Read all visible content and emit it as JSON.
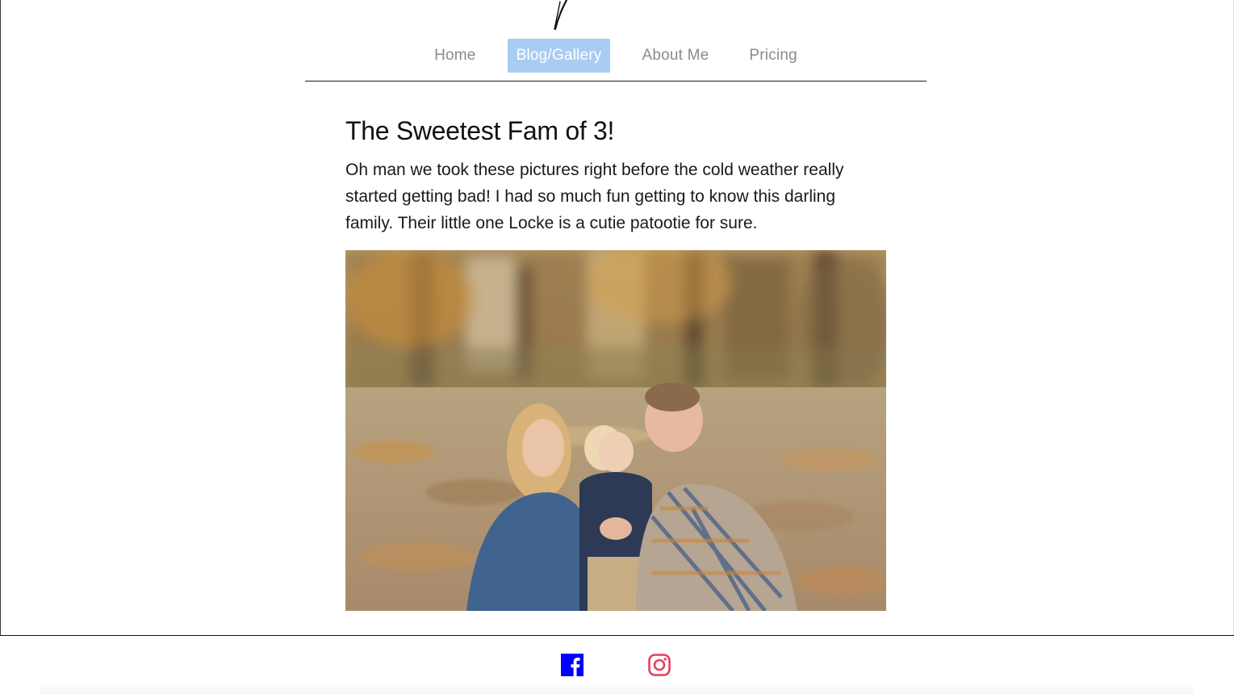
{
  "nav": {
    "items": [
      {
        "label": "Home",
        "active": false
      },
      {
        "label": "Blog/Gallery",
        "active": true
      },
      {
        "label": "About Me",
        "active": false
      },
      {
        "label": "Pricing",
        "active": false
      }
    ],
    "active_color": "#a9cdf2"
  },
  "post": {
    "title": "The Sweetest Fam of 3!",
    "body": "Oh man we took these pictures right before the cold weather really started getting bad! I had so much fun getting to know this darling family. Their little one Locke is a cutie patootie for sure."
  },
  "footer": {
    "social": [
      {
        "icon": "facebook-icon",
        "color": "#0000ff"
      },
      {
        "icon": "instagram-icon",
        "color": "#e4405f"
      }
    ]
  }
}
